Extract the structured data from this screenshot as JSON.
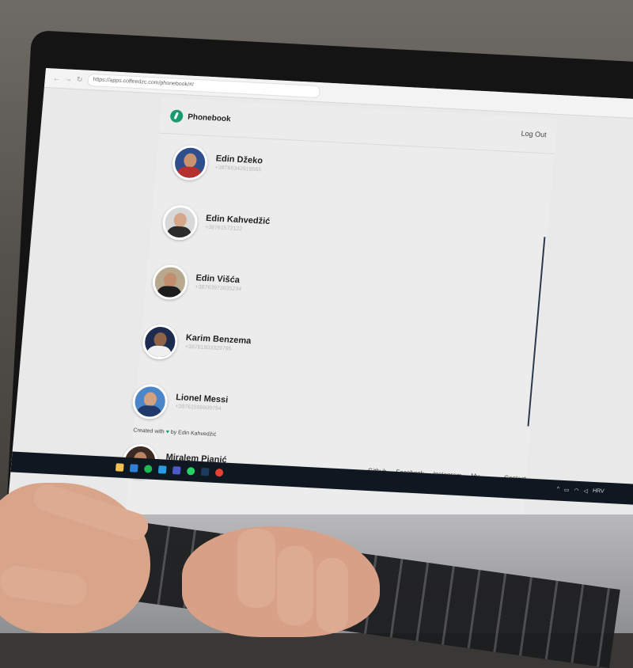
{
  "browser": {
    "url": "https://apps.coffeedzc.com/phonebook/#/"
  },
  "app": {
    "title": "Phonebook",
    "logout_label": "Log Out",
    "brand_color": "#1b9a6e"
  },
  "contacts": [
    {
      "name": "Edin Džeko",
      "phone": "+38766342919565",
      "avatar": "avatar-photo"
    },
    {
      "name": "Edin Kahvedžić",
      "phone": "+38761572122",
      "avatar": "avatar-photo"
    },
    {
      "name": "Edin Višća",
      "phone": "+38763973935234",
      "avatar": "avatar-photo"
    },
    {
      "name": "Karim Benzema",
      "phone": "+38761803329795",
      "avatar": "avatar-photo"
    },
    {
      "name": "Lionel Messi",
      "phone": "+38761596609754",
      "avatar": "avatar-photo"
    },
    {
      "name": "Miralem Pjanić",
      "phone": "",
      "avatar": "avatar-photo"
    }
  ],
  "footer": {
    "credit_prefix": "Created with",
    "credit_suffix": "by Edin Kahvedžić",
    "links": [
      "Github",
      "Facebook",
      "Instagram",
      "My website",
      "Contact"
    ]
  },
  "taskbar": {
    "tray_text": "HRV"
  }
}
